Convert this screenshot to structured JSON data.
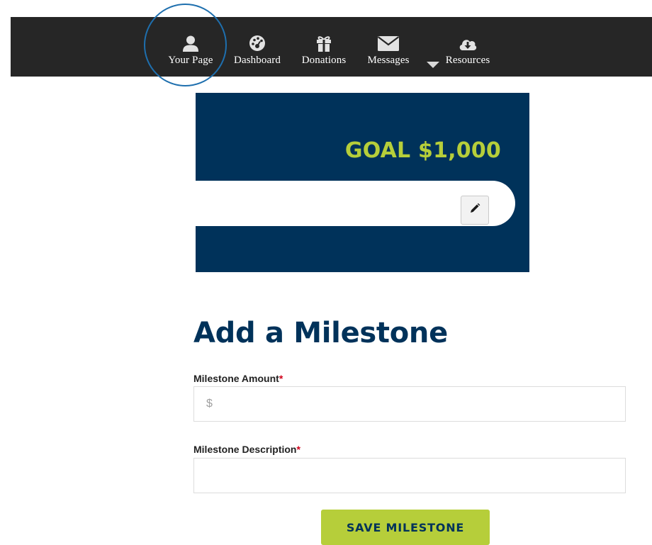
{
  "nav": {
    "items": [
      {
        "label": "Your Page",
        "icon": "user-icon"
      },
      {
        "label": "Dashboard",
        "icon": "dashboard-gauge-icon"
      },
      {
        "label": "Donations",
        "icon": "gift-icon"
      },
      {
        "label": "Messages",
        "icon": "envelope-icon"
      },
      {
        "label": "Resources",
        "icon": "cloud-download-icon"
      }
    ],
    "active": "Your Page"
  },
  "banner": {
    "goal_text": "GOAL $1,000",
    "progress": 0,
    "edit_icon": "pencil-icon"
  },
  "form": {
    "title": "Add a Milestone",
    "amount_label": "Milestone Amount",
    "amount_placeholder": "$",
    "amount_value": "",
    "description_label": "Milestone Description",
    "description_value": "",
    "required_marker": "*",
    "save_label": "SAVE MILESTONE"
  },
  "colors": {
    "nav_bg": "#262626",
    "brand_navy": "#00325a",
    "accent_green": "#b6ce3a",
    "highlight_ring": "#1e6fae",
    "required": "#d0021b"
  }
}
